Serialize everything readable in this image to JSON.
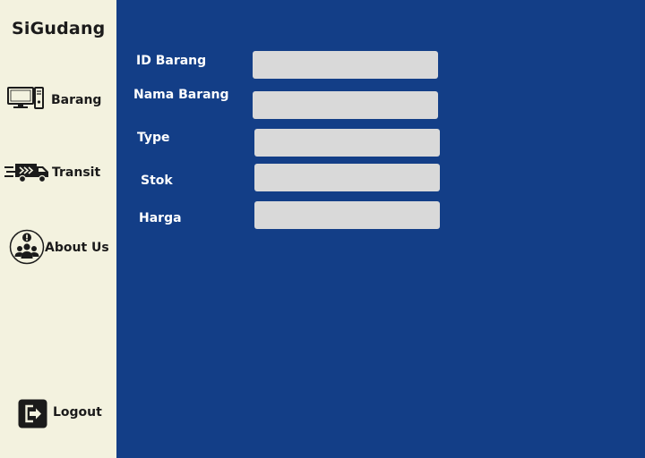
{
  "app": {
    "title": "SiGudang"
  },
  "sidebar": {
    "items": [
      {
        "label": "Barang",
        "icon": "computer-icon"
      },
      {
        "label": "Transit",
        "icon": "delivery-truck-icon"
      },
      {
        "label": "About Us",
        "icon": "group-info-icon"
      }
    ],
    "logout": {
      "label": "Logout",
      "icon": "logout-icon"
    }
  },
  "form": {
    "fields": [
      {
        "label": "ID Barang",
        "value": "",
        "placeholder": ""
      },
      {
        "label": "Nama Barang",
        "value": "",
        "placeholder": ""
      },
      {
        "label": "Type",
        "value": "",
        "placeholder": ""
      },
      {
        "label": "Stok",
        "value": "",
        "placeholder": ""
      },
      {
        "label": "Harga",
        "value": "",
        "placeholder": ""
      }
    ]
  },
  "colors": {
    "sidebar_bg": "#F3F2DF",
    "main_bg": "#133E87",
    "input_bg": "#D9D9D9",
    "text_dark": "#1B1B1B",
    "text_light": "#FFFFFF"
  }
}
